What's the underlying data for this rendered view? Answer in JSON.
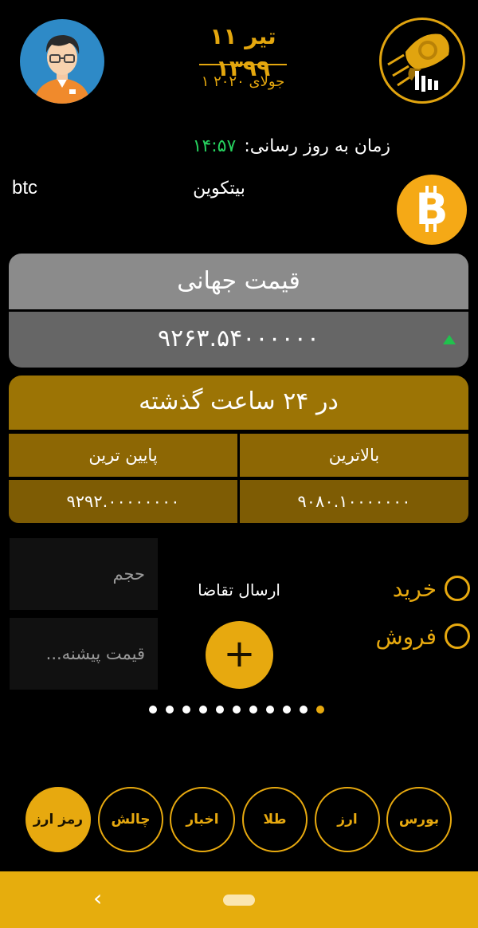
{
  "header": {
    "date_shamsi": "۱۱ تیر ۱۳۹۹",
    "date_gregorian": "۱ جولای ۲۰۲۰"
  },
  "update": {
    "label": "زمان به روز رسانی:",
    "time": "۱۴:۵۷"
  },
  "coin": {
    "symbol": "btc",
    "name": "بیتکوین",
    "icon": "bitcoin-icon",
    "icon_color": "#f5a916"
  },
  "global_price": {
    "title": "قیمت جهانی",
    "value": "۹۲۶۳.۵۴۰۰۰۰۰۰",
    "trend": "up"
  },
  "last_24h": {
    "title": "در ۲۴ ساعت گذشته",
    "high_label": "بالاترین",
    "low_label": "پایین ترین",
    "high_value": "۹۰۸۰.۱۰۰۰۰۰۰۰",
    "low_value": "۹۲۹۲.۰۰۰۰۰۰۰۰"
  },
  "order": {
    "volume_placeholder": "حجم",
    "price_placeholder": "قیمت پیشنه...",
    "send_label": "ارسال تقاضا",
    "plus_symbol": "+",
    "buy_label": "خرید",
    "sell_label": "فروش"
  },
  "pager": {
    "total": 11,
    "active_index": 10
  },
  "nav": {
    "items": [
      "بورس",
      "ارز",
      "طلا",
      "اخبار",
      "چالش",
      "رمز ارز"
    ],
    "active": "رمز ارز"
  },
  "system_bar": {
    "back_glyph": "‹"
  },
  "colors": {
    "accent": "#e7a90f",
    "price_header_bg": "#8b8b8b",
    "price_value_bg": "#666666",
    "h24_header_bg": "#9c7405",
    "trend_up": "#20c24d",
    "time_green": "#26d05e"
  }
}
